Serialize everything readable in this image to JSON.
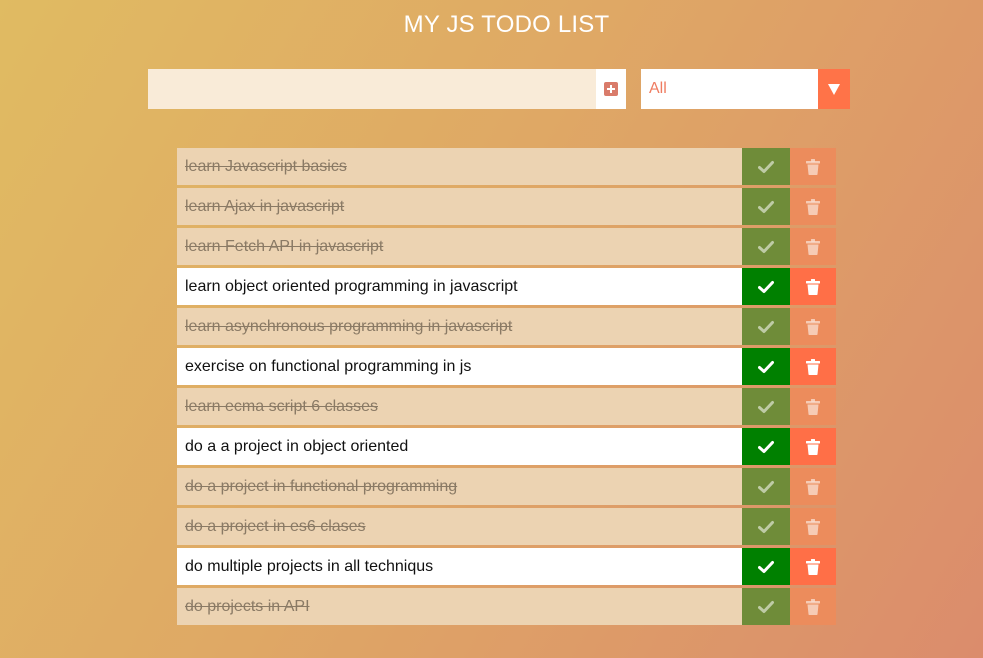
{
  "header": {
    "title": "MY JS TODO LIST"
  },
  "add_form": {
    "input_value": "",
    "input_placeholder": "",
    "add_icon": "plus-square-icon"
  },
  "filter": {
    "selected": "All",
    "arrow_icon": "caret-down-icon"
  },
  "colors": {
    "check_active": "#008000",
    "check_completed": "#6f8c39",
    "trash_active": "#ff6f47",
    "trash_completed": "#ec8c5c",
    "row_completed_bg": "#ecd3b2"
  },
  "todos": [
    {
      "text": "learn Javascript basics",
      "completed": true
    },
    {
      "text": "learn Ajax in javascript",
      "completed": true
    },
    {
      "text": "learn Fetch API in javascript",
      "completed": true
    },
    {
      "text": "learn object oriented programming in javascript",
      "completed": false
    },
    {
      "text": "learn asynchronous programming in javascript",
      "completed": true
    },
    {
      "text": "exercise on functional programming in js",
      "completed": false
    },
    {
      "text": "learn ecma script 6 classes",
      "completed": true
    },
    {
      "text": "do a a project in object oriented",
      "completed": false
    },
    {
      "text": "do a project in functional programming",
      "completed": true
    },
    {
      "text": "do a project in es6 clases",
      "completed": true
    },
    {
      "text": "do multiple projects in all techniqus",
      "completed": false
    },
    {
      "text": "do projects in API",
      "completed": true
    }
  ]
}
